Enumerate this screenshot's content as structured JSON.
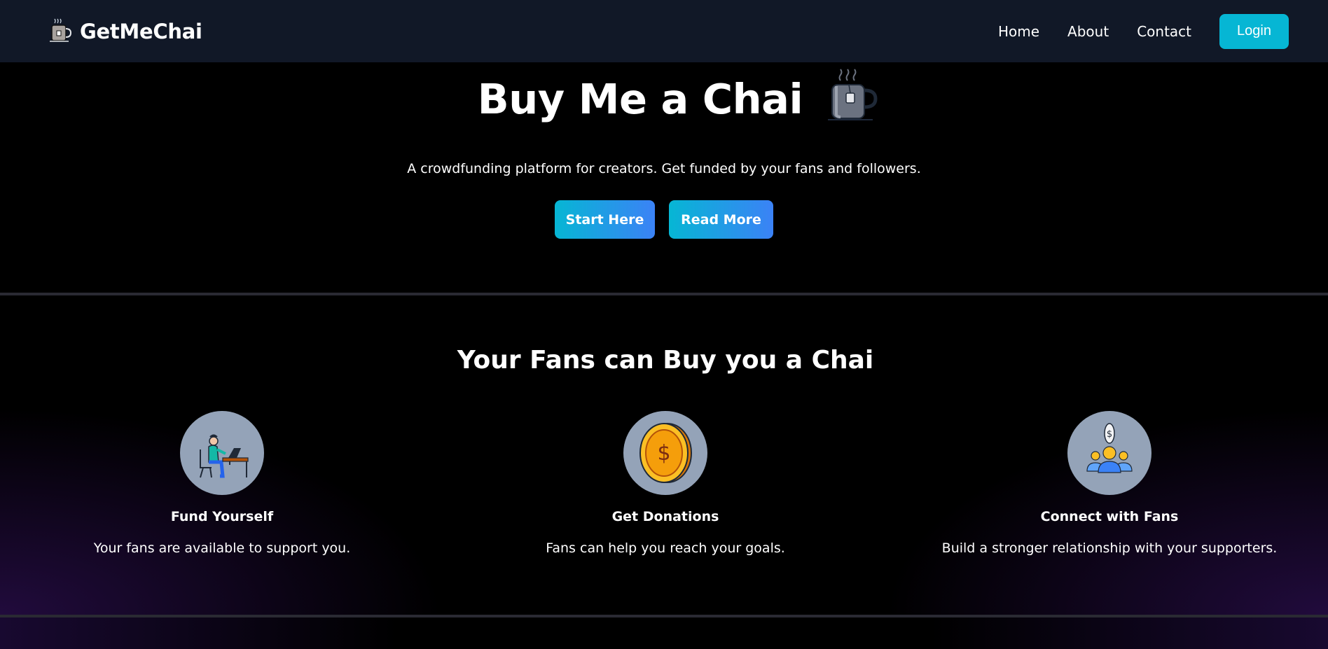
{
  "nav": {
    "brand": "GetMeChai",
    "links": [
      "Home",
      "About",
      "Contact"
    ],
    "login": "Login"
  },
  "hero": {
    "title": "Buy Me a Chai",
    "subtitle": "A crowdfunding platform for creators. Get funded by your fans and followers.",
    "buttons": [
      "Start Here",
      "Read More"
    ]
  },
  "features": {
    "heading": "Your Fans can Buy you a Chai",
    "items": [
      {
        "icon": "working-person-icon",
        "title": "Fund Yourself",
        "desc": "Your fans are available to support you."
      },
      {
        "icon": "coin-icon",
        "title": "Get Donations",
        "desc": "Fans can help you reach your goals."
      },
      {
        "icon": "group-icon",
        "title": "Connect with Fans",
        "desc": "Build a stronger relationship with your supporters."
      }
    ]
  },
  "colors": {
    "navbar": "#111827",
    "accent": "#06b6d4",
    "gradient_end": "#3b82f6",
    "icon_circle": "#94a3b8"
  }
}
